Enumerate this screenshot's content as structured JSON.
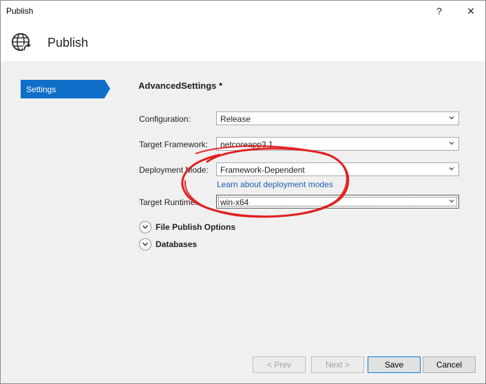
{
  "window": {
    "title": "Publish",
    "help_glyph": "?",
    "close_glyph": "✕"
  },
  "header": {
    "icon": "globe-upload-icon",
    "title": "Publish"
  },
  "sidebar": {
    "items": [
      {
        "label": "Settings",
        "selected": true
      }
    ]
  },
  "main": {
    "section_title": "AdvancedSettings *",
    "fields": {
      "configuration": {
        "label": "Configuration:",
        "value": "Release"
      },
      "target_framework": {
        "label": "Target Framework:",
        "value": "netcoreapp3.1"
      },
      "deployment_mode": {
        "label": "Deployment Mode:",
        "value": "Framework-Dependent"
      },
      "target_runtime": {
        "label": "Target Runtime:",
        "value": "win-x64"
      }
    },
    "learn_link": "Learn about deployment modes",
    "expanders": [
      {
        "label": "File Publish Options"
      },
      {
        "label": "Databases"
      }
    ]
  },
  "footer": {
    "prev": "< Prev",
    "next": "Next >",
    "save": "Save",
    "cancel": "Cancel"
  },
  "colors": {
    "accent": "#0e6ec8",
    "annotation": "#e02020",
    "link": "#1a5fb4"
  }
}
